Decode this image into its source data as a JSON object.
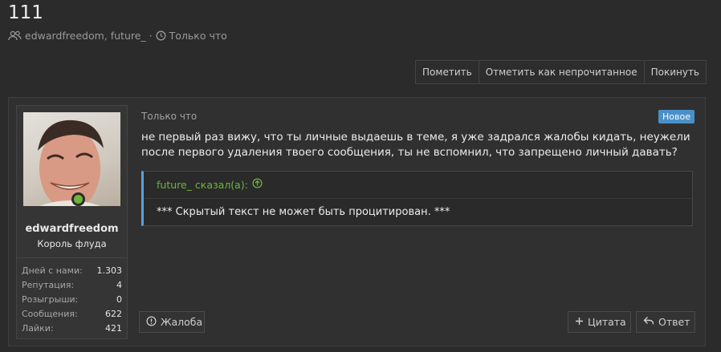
{
  "thread": {
    "title": "111",
    "participants": "edwardfreedom, future_",
    "separator": "·",
    "time": "Только что"
  },
  "actions": [
    {
      "label": "Пометить"
    },
    {
      "label": "Отметить как непрочитанное"
    },
    {
      "label": "Покинуть"
    }
  ],
  "post": {
    "time": "Только что",
    "badge": "Новое",
    "message": "не первый раз вижу, что ты личные выдаешь в теме, я уже задрался жалобы кидать, неужели после первого удаления твоего сообщения, ты не вспомнил, что запрещено личный давать?",
    "quote": {
      "author": "future_ сказал(а):",
      "text": "*** Скрытый текст не может быть процитирован. ***"
    },
    "buttons": {
      "report": "Жалоба",
      "quote": "Цитата",
      "reply": "Ответ"
    },
    "colors": {
      "accent": "#4a90c8",
      "online": "#6fb53b"
    }
  },
  "user": {
    "name": "edwardfreedom",
    "rank": "Король флуда",
    "stats": [
      {
        "key": "Дней с нами:",
        "value": "1.303"
      },
      {
        "key": "Репутация:",
        "value": "4"
      },
      {
        "key": "Розыгрыши:",
        "value": "0"
      },
      {
        "key": "Сообщения:",
        "value": "622"
      },
      {
        "key": "Лайки:",
        "value": "421"
      }
    ]
  }
}
